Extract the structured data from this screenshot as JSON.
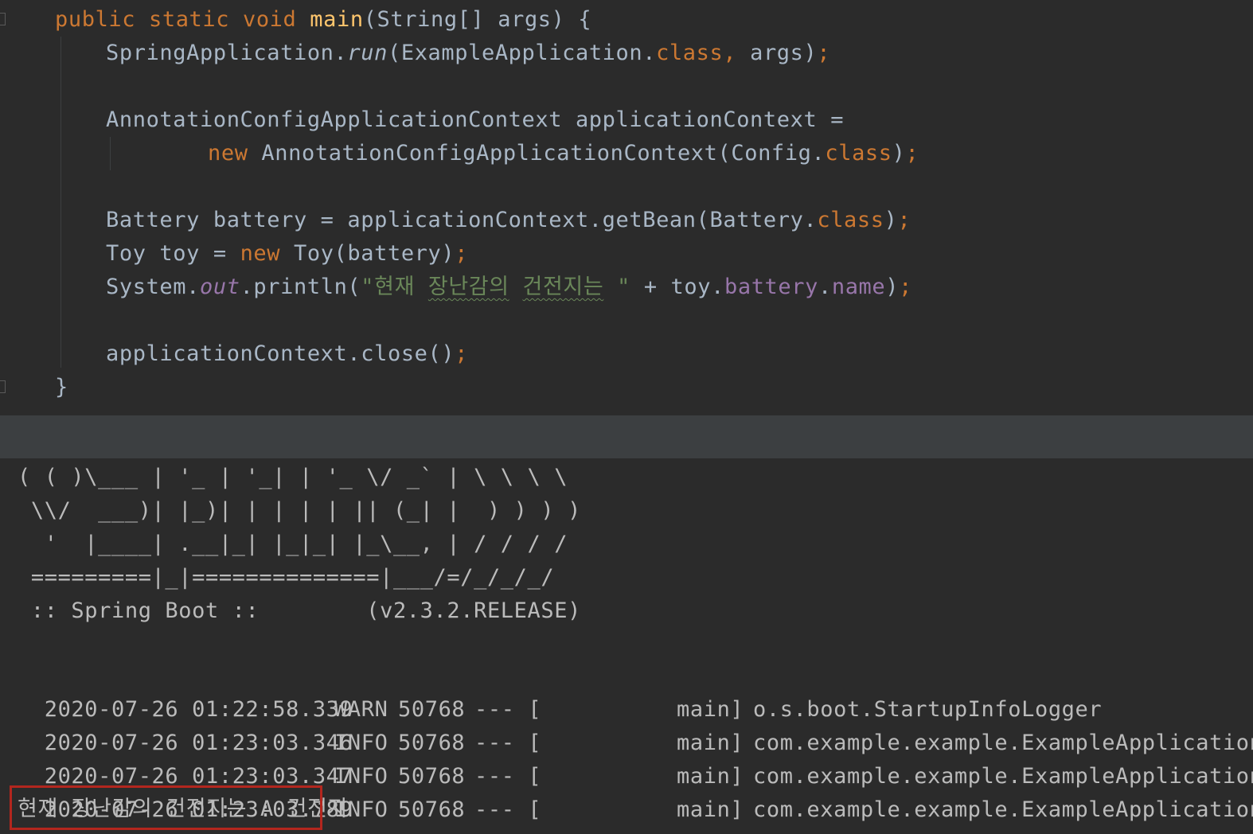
{
  "code": {
    "line1": {
      "kw1": "public static void ",
      "fn": "main",
      "rest": "(String[] args) {"
    },
    "line2": {
      "a": "SpringApplication.",
      "b": "run",
      "c": "(ExampleApplication.",
      "d": "class",
      "e": ", args",
      "f": ");",
      "semi": ""
    },
    "line3": {
      "text": "AnnotationConfigApplicationContext applicationContext ="
    },
    "line4": {
      "kw": "new ",
      "a": "AnnotationConfigApplicationContext(Config.",
      "b": "class",
      "c": ");"
    },
    "line5": {
      "a": "Battery battery = applicationContext.getBean(Battery.",
      "b": "class",
      "c": ")",
      "d": ";"
    },
    "line6": {
      "a": "Toy toy = ",
      "kw": "new ",
      "b": "Toy(battery)",
      "c": ";"
    },
    "line7": {
      "a": "System.",
      "b": "out",
      "c": ".println(",
      "s1": "\"현재 ",
      "s2": "장난감의",
      "s3": " ",
      "s4": "건전지는",
      "s5": " \"",
      "d": " + toy.",
      "e": "battery",
      "f": ".",
      "g": "name",
      "h": ")",
      "i": ";"
    },
    "line8": {
      "a": "applicationContext.close()",
      "b": ";"
    },
    "line9": {
      "text": "}"
    }
  },
  "console": {
    "banner": [
      "( ( )\\___ | '_ | '_| | '_ \\/ _` | \\ \\ \\ \\",
      " \\\\/  ___)| |_)| | | | | || (_| |  ) ) ) )",
      "  '  |____| .__|_| |_|_| |_\\__, | / / / /",
      " =========|_|==============|___/=/_/_/_/",
      " :: Spring Boot ::        (v2.3.2.RELEASE)"
    ],
    "logs": [
      {
        "time": "2020-07-26 01:22:58.339",
        "level": "WARN",
        "pid": "50768",
        "sep": "--- [",
        "thread": "main]",
        "logger": "o.s.boot.StartupInfoLogger"
      },
      {
        "time": "2020-07-26 01:23:03.346",
        "level": "INFO",
        "pid": "50768",
        "sep": "--- [",
        "thread": "main]",
        "logger": "com.example.example.ExampleApplication"
      },
      {
        "time": "2020-07-26 01:23:03.347",
        "level": "INFO",
        "pid": "50768",
        "sep": "--- [",
        "thread": "main]",
        "logger": "com.example.example.ExampleApplication"
      },
      {
        "time": "2020-07-26 01:23:03.789",
        "level": "INFO",
        "pid": "50768",
        "sep": "--- [",
        "thread": "main]",
        "logger": "com.example.example.ExampleApplication"
      }
    ],
    "output": "현재 장난감의 건전지는 A 건전지"
  },
  "colors": {
    "background": "#2b2b2b",
    "keyword": "#cc7832",
    "function": "#ffc66d",
    "string": "#6a8759",
    "field": "#9876aa",
    "highlight_border": "#b3261e"
  }
}
